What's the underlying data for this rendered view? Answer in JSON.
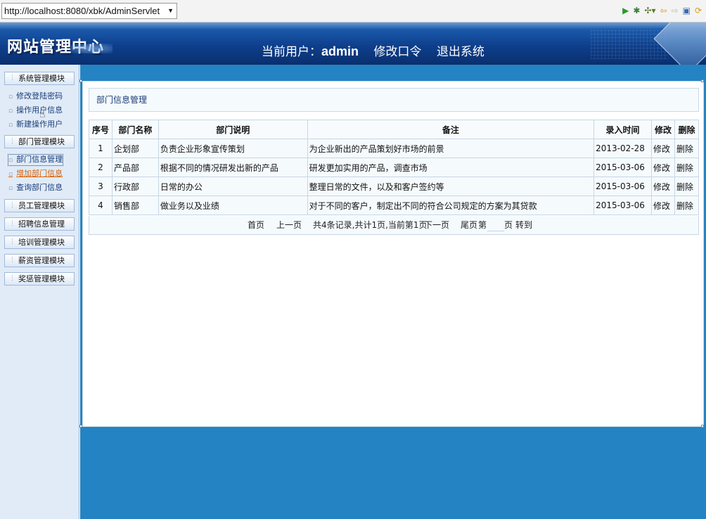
{
  "browser": {
    "url": "http://localhost:8080/xbk/AdminServlet",
    "icons": [
      "run-icon",
      "debug-icon",
      "tools-icon",
      "back-icon",
      "forward-icon",
      "page-icon",
      "refresh-icon"
    ]
  },
  "header": {
    "logo": "网站管理中心",
    "current_user_label": "当前用户：",
    "current_user": "admin",
    "change_password": "修改口令",
    "logout": "退出系统"
  },
  "sidebar": {
    "modules": [
      {
        "label": "系统管理模块",
        "items": [
          "修改登陆密码",
          "操作用户信息",
          "新建操作用户"
        ]
      },
      {
        "label": "部门管理模块",
        "items": [
          "部门信息管理",
          "增加部门信息",
          "查询部门信息"
        ]
      },
      {
        "label": "员工管理模块",
        "items": []
      },
      {
        "label": "招聘信息管理",
        "items": []
      },
      {
        "label": "培训管理模块",
        "items": []
      },
      {
        "label": "薪资管理模块",
        "items": []
      },
      {
        "label": "奖惩管理模块",
        "items": []
      }
    ]
  },
  "main": {
    "title": "部门信息管理",
    "columns": [
      "序号",
      "部门名称",
      "部门说明",
      "备注",
      "录入时间",
      "修改",
      "删除"
    ],
    "rows": [
      [
        "1",
        "企划部",
        "负责企业形象宣传策划",
        "为企业新出的产品策划好市场的前景",
        "2013-02-28",
        "修改",
        "删除"
      ],
      [
        "2",
        "产品部",
        "根据不同的情况研发出新的产品",
        "研发更加实用的产品，调查市场",
        "2015-03-06",
        "修改",
        "删除"
      ],
      [
        "3",
        "行政部",
        "日常的办公",
        "整理日常的文件，以及和客户签约等",
        "2015-03-06",
        "修改",
        "删除"
      ],
      [
        "4",
        "销售部",
        "做业务以及业绩",
        "对于不同的客户，制定出不同的符合公司规定的方案为其贷款",
        "2015-03-06",
        "修改",
        "删除"
      ]
    ],
    "pager": {
      "first": "首页",
      "prev": "上一页",
      "summary": "共4条记录,共计1页,当前第1页",
      "next": "下一页",
      "last": "尾页",
      "goto_prefix": "第",
      "goto_suffix": "页",
      "goto_button": "转到"
    }
  }
}
